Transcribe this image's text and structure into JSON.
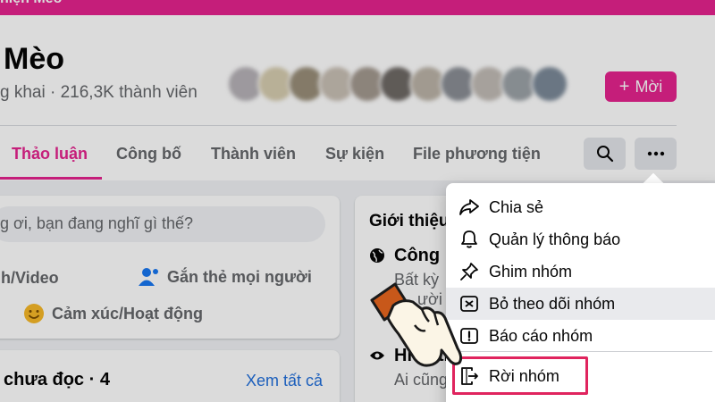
{
  "banner": {
    "text": "hiện Mèo"
  },
  "group": {
    "name": "Mèo",
    "meta": "g khai · 216,3K thành viên"
  },
  "invite_button": {
    "icon": "plus-icon",
    "label": "Mời"
  },
  "tabs": [
    {
      "label": "Thảo luận",
      "active": true
    },
    {
      "label": "Công bố",
      "active": false
    },
    {
      "label": "Thành viên",
      "active": false
    },
    {
      "label": "Sự kiện",
      "active": false
    },
    {
      "label": "File phương tiện",
      "active": false
    }
  ],
  "toolbar": {
    "search_icon": "search-icon",
    "more_icon": "more-horizontal-icon"
  },
  "composer": {
    "placeholder": "g ơi, bạn đang nghĩ gì thế?",
    "actions": [
      {
        "label": "nh/Video",
        "icon": "photo-icon"
      },
      {
        "label": "Gắn thẻ mọi người",
        "icon": "tag-people-icon"
      },
      {
        "label": "Cảm xúc/Hoạt động",
        "icon": "smile-icon"
      }
    ]
  },
  "unread": {
    "title": "chưa đọc · 4",
    "see_all": "Xem tất cả"
  },
  "intro": {
    "title": "Giới thiệu",
    "public_title": "Công k",
    "public_desc_1": "Bất kỳ",
    "public_desc_2": "ười t",
    "visible_title": "Hiển th",
    "visible_desc": "Ai cũng"
  },
  "menu": {
    "items": [
      {
        "label": "Chia sẻ",
        "icon": "share-icon"
      },
      {
        "label": "Quản lý thông báo",
        "icon": "bell-icon"
      },
      {
        "label": "Ghim nhóm",
        "icon": "pin-icon"
      },
      {
        "label": "Bỏ theo dõi nhóm",
        "icon": "unfollow-icon"
      },
      {
        "label": "Báo cáo nhóm",
        "icon": "report-icon"
      },
      {
        "label": "Rời nhóm",
        "icon": "leave-group-icon"
      }
    ]
  },
  "colors": {
    "brand": "#e6238f",
    "highlight": "#e0245e",
    "link": "#216fdb"
  }
}
